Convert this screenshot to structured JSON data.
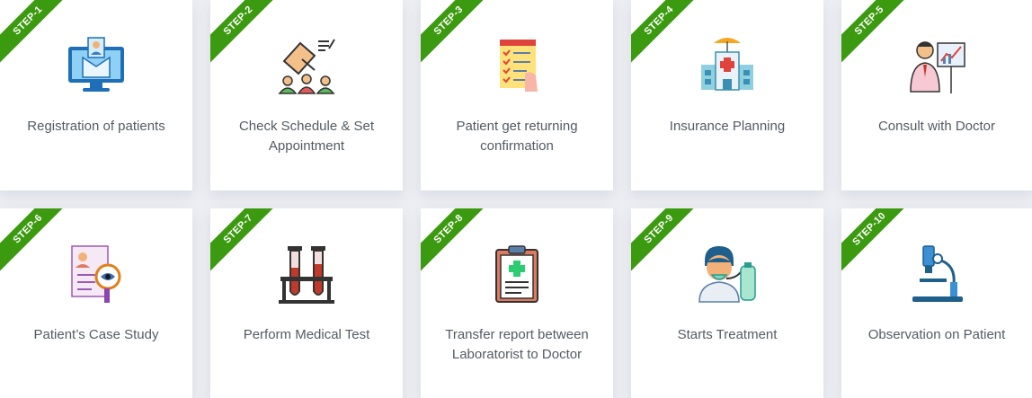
{
  "steps": [
    {
      "badge": "STEP-1",
      "title": "Registration of patients",
      "icon": "monitor-patient-icon"
    },
    {
      "badge": "STEP-2",
      "title": "Check Schedule & Set Appointment",
      "icon": "schedule-appointment-icon"
    },
    {
      "badge": "STEP-3",
      "title": "Patient get returning confirmation",
      "icon": "checklist-confirmation-icon"
    },
    {
      "badge": "STEP-4",
      "title": "Insurance Planning",
      "icon": "hospital-umbrella-icon"
    },
    {
      "badge": "STEP-5",
      "title": "Consult with Doctor",
      "icon": "doctor-presentation-icon"
    },
    {
      "badge": "STEP-6",
      "title": "Patient’s Case Study",
      "icon": "case-study-magnifier-icon"
    },
    {
      "badge": "STEP-7",
      "title": "Perform Medical Test",
      "icon": "test-tubes-icon"
    },
    {
      "badge": "STEP-8",
      "title": "Transfer report between Laboratorist to Doctor",
      "icon": "medical-report-clipboard-icon"
    },
    {
      "badge": "STEP-9",
      "title": "Starts Treatment",
      "icon": "patient-oxygen-mask-icon"
    },
    {
      "badge": "STEP-10",
      "title": "Observation on Patient",
      "icon": "microscope-icon"
    }
  ],
  "colors": {
    "ribbon": "#3c9a10",
    "card": "#ffffff",
    "page": "#eceef3",
    "text": "#555a63"
  }
}
